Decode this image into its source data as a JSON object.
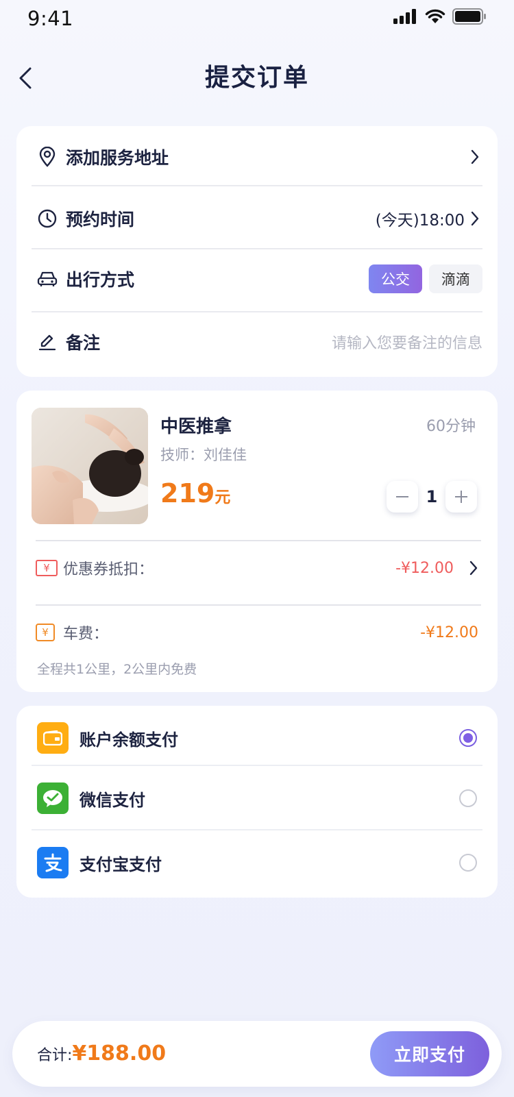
{
  "status_bar": {
    "time": "9:41"
  },
  "nav": {
    "title": "提交订单"
  },
  "order_info": {
    "address_label": "添加服务地址",
    "time_label": "预约时间",
    "time_value": "(今天)18:00",
    "travel_label": "出行方式",
    "travel_options": [
      "公交",
      "滴滴"
    ],
    "travel_selected": "公交",
    "note_label": "备注",
    "note_placeholder": "请输入您要备注的信息"
  },
  "service": {
    "name": "中医推拿",
    "duration": "60分钟",
    "technician": "技师：刘佳佳",
    "price": "219",
    "price_unit": "元",
    "quantity": "1"
  },
  "fees": {
    "coupon_icon": "¥",
    "coupon_label": "优惠券抵扣：",
    "coupon_value": "-¥12.00",
    "car_icon": "¥",
    "car_label": "车费：",
    "car_value": "-¥12.00",
    "car_note": "全程共1公里，2公里内免费"
  },
  "payment": {
    "methods": [
      {
        "label": "账户余额支付",
        "icon": "wallet-icon",
        "color": "#ffad12",
        "selected": true
      },
      {
        "label": "微信支付",
        "icon": "wechat-icon",
        "color": "#3cb035",
        "selected": false
      },
      {
        "label": "支付宝支付",
        "icon": "alipay-icon",
        "color": "#1b7cf2",
        "selected": false
      }
    ]
  },
  "footer": {
    "total_label": "合计:",
    "total_value": "¥188.00",
    "pay_button": "立即支付"
  },
  "colors": {
    "accent": "#7f5fe4",
    "price": "#f07a1a",
    "discount": "#ef5c5c",
    "text": "#1d2340",
    "muted": "#9a9dae"
  }
}
